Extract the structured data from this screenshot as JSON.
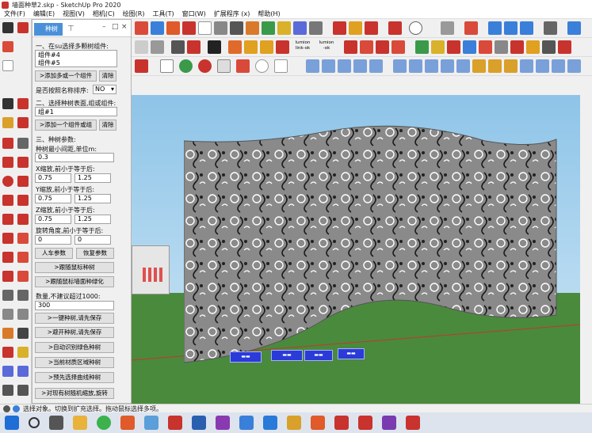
{
  "window": {
    "title": "墙面种草2.skp - SketchUp Pro 2020"
  },
  "menu": [
    "文件(F)",
    "编辑(E)",
    "视图(V)",
    "相机(C)",
    "绘图(R)",
    "工具(T)",
    "窗口(W)",
    "扩展程序 (x)",
    "帮助(H)"
  ],
  "toolbar": {
    "lumion_link": "lumion\nlink-ok",
    "lumion_ok": "lumion\n-ok"
  },
  "panel": {
    "tab_label": "种树",
    "step1_label": "一、在su选择多颗树组件:",
    "group_list": [
      "组件#4",
      "组件#5"
    ],
    "add_multi_btn": ">添加多或一个组件",
    "clear_btn_1": "清除",
    "sort_label": "是否按照名称排序:",
    "sort_value": "NO",
    "step2_label": "二、选择种树表面,组或组件:",
    "surface_value": "组#1",
    "add_one_btn": ">添加一个组件或组",
    "clear_btn_2": "清除",
    "step3_label": "三、种树参数:",
    "min_dist_label": "种树最小间距,单位m:",
    "min_dist_value": "0.3",
    "x_scale_label": "X缩放,前小于等于后:",
    "x_min": "0.75",
    "x_max": "1.25",
    "y_scale_label": "Y缩放,前小于等于后:",
    "y_min": "0.75",
    "y_max": "1.25",
    "z_scale_label": "Z缩放,前小于等于后:",
    "z_min": "0.75",
    "z_max": "1.25",
    "rot_label": "旋转角度,前小于等于后:",
    "rot_min": "0",
    "rot_max": "0",
    "person_btn": "人车参数",
    "restore_btn": "恢复参数",
    "follow_mouse_btn": ">跟随鼠标种树",
    "follow_surface_btn": ">跟随鼠标墙面种绿化",
    "count_label": "数量,不建议超过1000:",
    "count_value": "300",
    "one_click_btn": ">一键种树,请先保存",
    "avoid_btn": ">避开种树,请先保存",
    "green_btn": ">自动识别绿色种树",
    "material_btn": ">当前材质区域种树",
    "curve_btn": ">预先选择曲线种树",
    "random_btn": ">对现有树随机缩放,旋转"
  },
  "status": {
    "text": "选择对象。切换到扩充选择。拖动鼠标选择多项。"
  },
  "colors": {
    "accent": "#4a90d9",
    "sketchup_red": "#c8332d",
    "ground": "#4a8a3d",
    "sky": "#8ec4e8"
  }
}
